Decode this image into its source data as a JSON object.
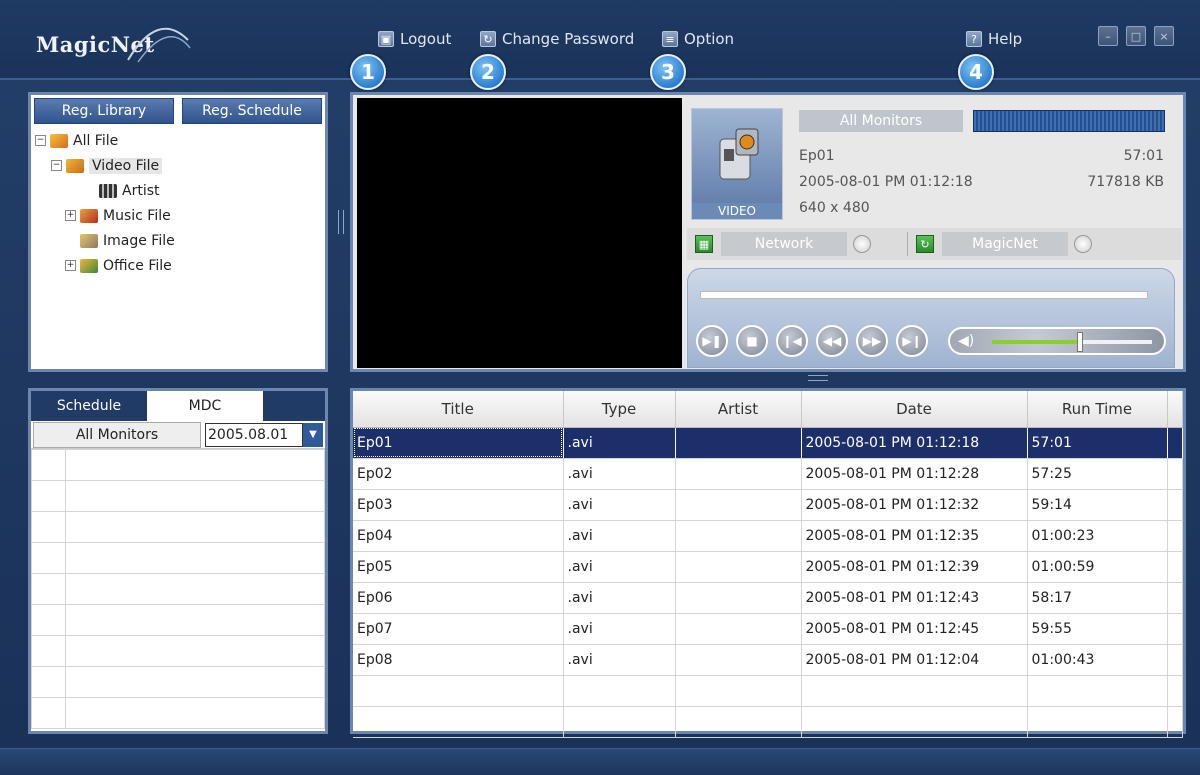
{
  "app": {
    "logo": "MagicNet"
  },
  "toolbar": {
    "logout": "Logout",
    "change_password": "Change Password",
    "option": "Option",
    "help": "Help"
  },
  "badges": [
    "1",
    "2",
    "3",
    "4"
  ],
  "library": {
    "tabs": [
      "Reg. Library",
      "Reg. Schedule"
    ],
    "tree": {
      "all": "All File",
      "video": "Video File",
      "artist": "Artist",
      "music": "Music File",
      "image": "Image File",
      "office": "Office File"
    }
  },
  "schedule": {
    "tabs": [
      "Schedule",
      "MDC"
    ],
    "monitor_button": "All Monitors",
    "date": "2005.08.01"
  },
  "player": {
    "thumb_label": "VIDEO",
    "monitors": "All Monitors",
    "title": "Ep01",
    "duration": "57:01",
    "date": "2005-08-01 PM 01:12:18",
    "size": "717818 KB",
    "resolution": "640 x 480",
    "network": "Network",
    "magicnet": "MagicNet",
    "volume_level": 0.55
  },
  "files": {
    "columns": [
      "Title",
      "Type",
      "Artist",
      "Date",
      "Run Time"
    ],
    "rows": [
      [
        "Ep01",
        ".avi",
        "",
        "2005-08-01 PM 01:12:18",
        "57:01"
      ],
      [
        "Ep02",
        ".avi",
        "",
        "2005-08-01 PM 01:12:28",
        "57:25"
      ],
      [
        "Ep03",
        ".avi",
        "",
        "2005-08-01 PM 01:12:32",
        "59:14"
      ],
      [
        "Ep04",
        ".avi",
        "",
        "2005-08-01 PM 01:12:35",
        "01:00:23"
      ],
      [
        "Ep05",
        ".avi",
        "",
        "2005-08-01 PM 01:12:39",
        "01:00:59"
      ],
      [
        "Ep06",
        ".avi",
        "",
        "2005-08-01 PM 01:12:43",
        "58:17"
      ],
      [
        "Ep07",
        ".avi",
        "",
        "2005-08-01 PM 01:12:45",
        "59:55"
      ],
      [
        "Ep08",
        ".avi",
        "",
        "2005-08-01 PM 01:12:04",
        "01:00:43"
      ]
    ]
  },
  "icons": {
    "logout": "lock-icon",
    "change_password": "refresh-icon",
    "option": "settings-icon",
    "help": "help-icon"
  }
}
